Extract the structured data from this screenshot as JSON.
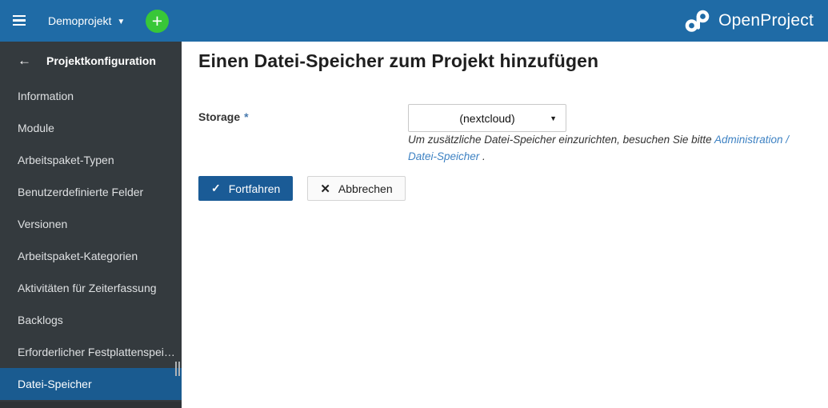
{
  "topbar": {
    "project_name": "Demoprojekt",
    "logo_text": "OpenProject"
  },
  "sidebar": {
    "header": "Projektkonfiguration",
    "items": [
      "Information",
      "Module",
      "Arbeitspaket-Typen",
      "Benutzerdefinierte Felder",
      "Versionen",
      "Arbeitspaket-Kategorien",
      "Aktivitäten für Zeiterfassung",
      "Backlogs",
      "Erforderlicher Festplattenspei…",
      "Datei-Speicher"
    ],
    "selected_item": "Datei-Speicher"
  },
  "main": {
    "title": "Einen Datei-Speicher zum Projekt hinzufügen",
    "form": {
      "storage_label": "Storage",
      "required_marker": "*",
      "storage_value": "(nextcloud)",
      "hint_prefix": "Um zusätzliche Datei-Speicher einzurichten, besuchen Sie bitte ",
      "hint_link": "Administration / Datei-Speicher",
      "hint_suffix": " ."
    },
    "buttons": {
      "continue_label": "Fortfahren",
      "cancel_label": "Abbrechen"
    }
  },
  "icons": {
    "back_arrow": "←",
    "check": "✓",
    "close": "✕",
    "caret_down": "▼",
    "caret_small": "▼",
    "plus": "+"
  },
  "colors": {
    "topbar_bg": "#1F6BA6",
    "sidebar_bg": "#343A3E",
    "selected_item_bg": "#1A5B90",
    "primary_button_bg": "#1A5B96",
    "plus_button_green": "#38C738",
    "link_blue": "#3E82C3",
    "required_marker": "#4779AD"
  }
}
